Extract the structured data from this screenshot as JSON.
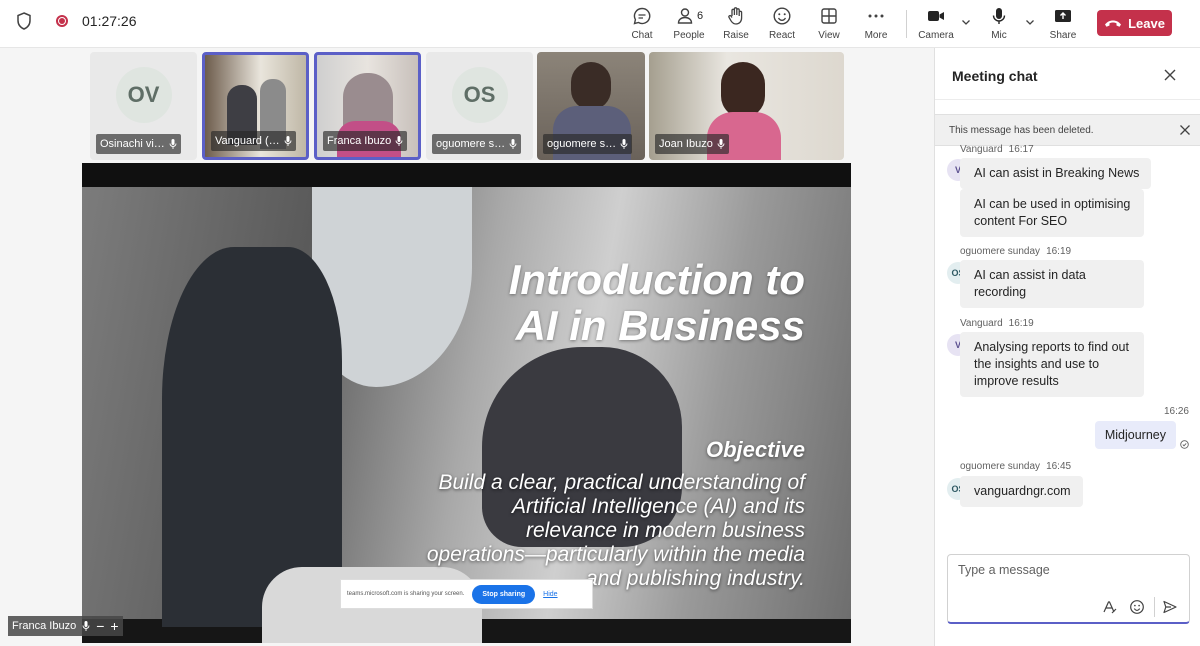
{
  "toolbar": {
    "timer": "01:27:26",
    "items": [
      {
        "label": "Chat",
        "icon": "chat-icon"
      },
      {
        "label": "People",
        "icon": "people-icon",
        "count": "6"
      },
      {
        "label": "Raise",
        "icon": "raise-hand-icon"
      },
      {
        "label": "React",
        "icon": "react-emoji-icon"
      },
      {
        "label": "View",
        "icon": "view-grid-icon"
      },
      {
        "label": "More",
        "icon": "more-icon"
      },
      {
        "label": "Camera",
        "icon": "camera-icon"
      },
      {
        "label": "Mic",
        "icon": "mic-icon"
      },
      {
        "label": "Share",
        "icon": "share-icon"
      }
    ],
    "leave_label": "Leave",
    "leave_color": "#c4314b",
    "accent": "#5b5fc7"
  },
  "participants": [
    {
      "name": "Osinachi vi…",
      "initials": "OV"
    },
    {
      "name": "Vanguard (…",
      "initials": ""
    },
    {
      "name": "Franca Ibuzo",
      "initials": ""
    },
    {
      "name": "oguomere s…",
      "initials": "OS"
    },
    {
      "name": "oguomere s…",
      "initials": ""
    },
    {
      "name": "Joan Ibuzo",
      "initials": ""
    }
  ],
  "slide": {
    "title_line1": "Introduction to",
    "title_line2": "AI in Business",
    "objective": "Objective",
    "body": "Build a clear, practical understanding of Artificial Intelligence (AI) and its relevance in modern business operations—particularly within the media and publishing industry."
  },
  "share_bar": {
    "text": "teams.microsoft.com is sharing your screen.",
    "stop_label": "Stop sharing",
    "hide_label": "Hide"
  },
  "self_view": {
    "name": "Franca Ibuzo"
  },
  "chat": {
    "title": "Meeting chat",
    "notice": "This message has been deleted.",
    "messages": [
      {
        "author": "Vanguard",
        "time": "16:17",
        "initial": "V",
        "texts": [
          "AI can asist in Breaking News",
          "AI can be used in optimising content For SEO"
        ]
      },
      {
        "author": "oguomere sunday",
        "time": "16:19",
        "initial": "OS",
        "texts": [
          "AI can assist in data recording"
        ]
      },
      {
        "author": "Vanguard",
        "time": "16:19",
        "initial": "V",
        "texts": [
          "Analysing reports to find out the insights and use to improve results"
        ]
      },
      {
        "author": "",
        "time": "16:26",
        "initial": "",
        "texts": [
          "Midjourney"
        ]
      },
      {
        "author": "oguomere sunday",
        "time": "16:45",
        "initial": "OS",
        "texts": [
          "vanguardngr.com"
        ]
      }
    ],
    "compose_placeholder": "Type a message"
  }
}
